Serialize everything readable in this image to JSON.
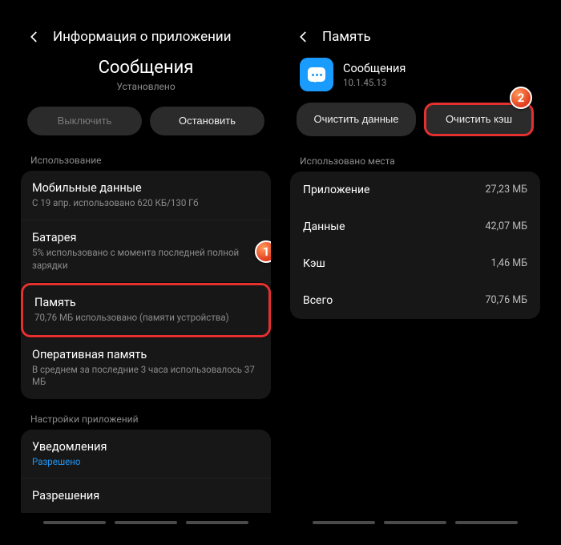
{
  "left": {
    "header_title": "Информация о приложении",
    "app_title": "Сообщения",
    "app_status": "Установлено",
    "btn_disable": "Выключить",
    "btn_stop": "Остановить",
    "section_usage": "Использование",
    "rows": {
      "mobile": {
        "title": "Мобильные данные",
        "sub": "С 19 апр. использовано 620 КБ/130 Гб"
      },
      "battery": {
        "title": "Батарея",
        "sub": "5% использовано с момента последней полной зарядки"
      },
      "storage": {
        "title": "Память",
        "sub": "70,76 МБ использовано (памяти устройства)"
      },
      "ram": {
        "title": "Оперативная память",
        "sub": "В среднем за последние 3 часа использовалось 37 МБ"
      }
    },
    "section_app": "Настройки приложений",
    "notif": {
      "title": "Уведомления",
      "link": "Разрешено"
    },
    "perm": {
      "title": "Разрешения"
    }
  },
  "right": {
    "header_title": "Память",
    "app_name": "Сообщения",
    "app_version": "10.1.45.13",
    "btn_clear_data": "Очистить данные",
    "btn_clear_cache": "Очистить кэш",
    "section_used": "Использовано места",
    "rows": {
      "app": {
        "label": "Приложение",
        "val": "27,23 МБ"
      },
      "data": {
        "label": "Данные",
        "val": "42,07 МБ"
      },
      "cache": {
        "label": "Кэш",
        "val": "1,46 МБ"
      },
      "total": {
        "label": "Всего",
        "val": "70,76 МБ"
      }
    }
  },
  "badges": {
    "one": "1",
    "two": "2"
  }
}
